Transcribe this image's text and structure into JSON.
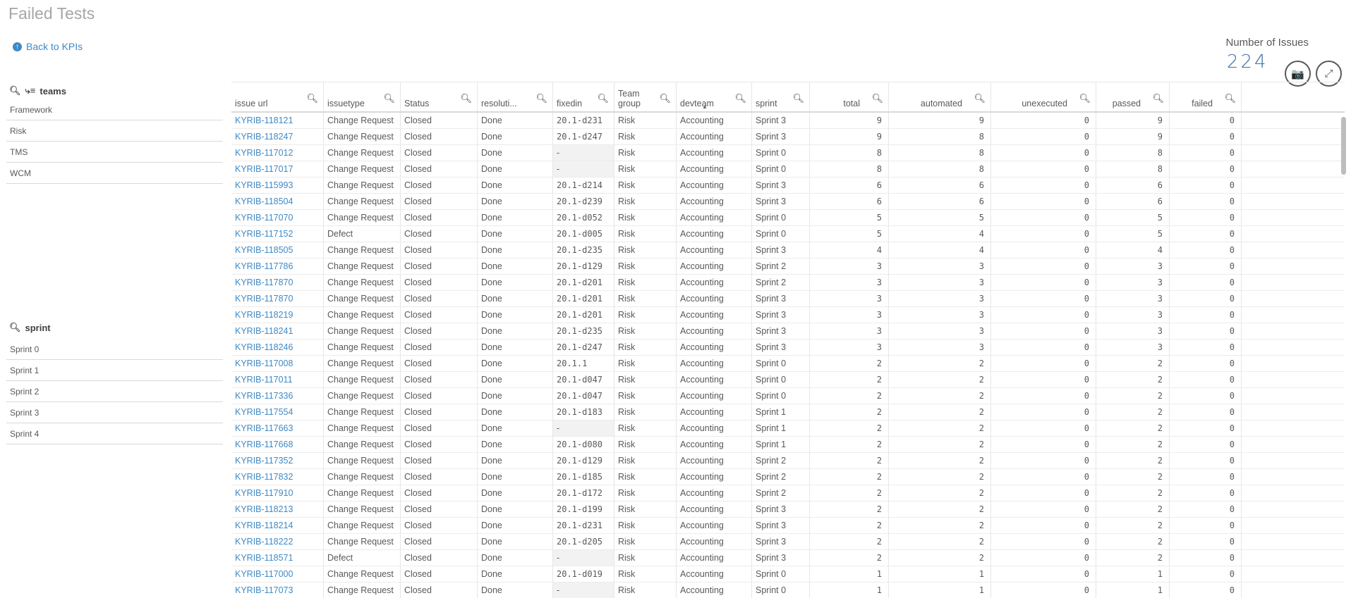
{
  "page_title": "Failed Tests",
  "back_link": "Back to KPIs",
  "kpi": {
    "label": "Number of Issues",
    "value": "224"
  },
  "filters": {
    "teams": {
      "label": "teams",
      "items": [
        "Framework",
        "Risk",
        "TMS",
        "WCM"
      ]
    },
    "sprint": {
      "label": "sprint",
      "items": [
        "Sprint 0",
        "Sprint 1",
        "Sprint 2",
        "Sprint 3",
        "Sprint 4"
      ]
    }
  },
  "table": {
    "columns": [
      "issue url",
      "issuetype",
      "Status",
      "resoluti...",
      "fixedin",
      "Team group",
      "devteam",
      "sprint",
      "total",
      "automated",
      "unexecuted",
      "passed",
      "failed"
    ],
    "rows": [
      [
        "KYRIB-118121",
        "Change Request",
        "Closed",
        "Done",
        "20.1-d231",
        "Risk",
        "Accounting",
        "Sprint 3",
        "9",
        "9",
        "0",
        "9",
        "0"
      ],
      [
        "KYRIB-118247",
        "Change Request",
        "Closed",
        "Done",
        "20.1-d247",
        "Risk",
        "Accounting",
        "Sprint 3",
        "9",
        "8",
        "0",
        "9",
        "0"
      ],
      [
        "KYRIB-117012",
        "Change Request",
        "Closed",
        "Done",
        "-",
        "Risk",
        "Accounting",
        "Sprint 0",
        "8",
        "8",
        "0",
        "8",
        "0"
      ],
      [
        "KYRIB-117017",
        "Change Request",
        "Closed",
        "Done",
        "-",
        "Risk",
        "Accounting",
        "Sprint 0",
        "8",
        "8",
        "0",
        "8",
        "0"
      ],
      [
        "KYRIB-115993",
        "Change Request",
        "Closed",
        "Done",
        "20.1-d214",
        "Risk",
        "Accounting",
        "Sprint 3",
        "6",
        "6",
        "0",
        "6",
        "0"
      ],
      [
        "KYRIB-118504",
        "Change Request",
        "Closed",
        "Done",
        "20.1-d239",
        "Risk",
        "Accounting",
        "Sprint 3",
        "6",
        "6",
        "0",
        "6",
        "0"
      ],
      [
        "KYRIB-117070",
        "Change Request",
        "Closed",
        "Done",
        "20.1-d052",
        "Risk",
        "Accounting",
        "Sprint 0",
        "5",
        "5",
        "0",
        "5",
        "0"
      ],
      [
        "KYRIB-117152",
        "Defect",
        "Closed",
        "Done",
        "20.1-d005",
        "Risk",
        "Accounting",
        "Sprint 0",
        "5",
        "4",
        "0",
        "5",
        "0"
      ],
      [
        "KYRIB-118505",
        "Change Request",
        "Closed",
        "Done",
        "20.1-d235",
        "Risk",
        "Accounting",
        "Sprint 3",
        "4",
        "4",
        "0",
        "4",
        "0"
      ],
      [
        "KYRIB-117786",
        "Change Request",
        "Closed",
        "Done",
        "20.1-d129",
        "Risk",
        "Accounting",
        "Sprint 2",
        "3",
        "3",
        "0",
        "3",
        "0"
      ],
      [
        "KYRIB-117870",
        "Change Request",
        "Closed",
        "Done",
        "20.1-d201",
        "Risk",
        "Accounting",
        "Sprint 2",
        "3",
        "3",
        "0",
        "3",
        "0"
      ],
      [
        "KYRIB-117870",
        "Change Request",
        "Closed",
        "Done",
        "20.1-d201",
        "Risk",
        "Accounting",
        "Sprint 3",
        "3",
        "3",
        "0",
        "3",
        "0"
      ],
      [
        "KYRIB-118219",
        "Change Request",
        "Closed",
        "Done",
        "20.1-d201",
        "Risk",
        "Accounting",
        "Sprint 3",
        "3",
        "3",
        "0",
        "3",
        "0"
      ],
      [
        "KYRIB-118241",
        "Change Request",
        "Closed",
        "Done",
        "20.1-d235",
        "Risk",
        "Accounting",
        "Sprint 3",
        "3",
        "3",
        "0",
        "3",
        "0"
      ],
      [
        "KYRIB-118246",
        "Change Request",
        "Closed",
        "Done",
        "20.1-d247",
        "Risk",
        "Accounting",
        "Sprint 3",
        "3",
        "3",
        "0",
        "3",
        "0"
      ],
      [
        "KYRIB-117008",
        "Change Request",
        "Closed",
        "Done",
        "20.1.1",
        "Risk",
        "Accounting",
        "Sprint 0",
        "2",
        "2",
        "0",
        "2",
        "0"
      ],
      [
        "KYRIB-117011",
        "Change Request",
        "Closed",
        "Done",
        "20.1-d047",
        "Risk",
        "Accounting",
        "Sprint 0",
        "2",
        "2",
        "0",
        "2",
        "0"
      ],
      [
        "KYRIB-117336",
        "Change Request",
        "Closed",
        "Done",
        "20.1-d047",
        "Risk",
        "Accounting",
        "Sprint 0",
        "2",
        "2",
        "0",
        "2",
        "0"
      ],
      [
        "KYRIB-117554",
        "Change Request",
        "Closed",
        "Done",
        "20.1-d183",
        "Risk",
        "Accounting",
        "Sprint 1",
        "2",
        "2",
        "0",
        "2",
        "0"
      ],
      [
        "KYRIB-117663",
        "Change Request",
        "Closed",
        "Done",
        "-",
        "Risk",
        "Accounting",
        "Sprint 1",
        "2",
        "2",
        "0",
        "2",
        "0"
      ],
      [
        "KYRIB-117668",
        "Change Request",
        "Closed",
        "Done",
        "20.1-d080",
        "Risk",
        "Accounting",
        "Sprint 1",
        "2",
        "2",
        "0",
        "2",
        "0"
      ],
      [
        "KYRIB-117352",
        "Change Request",
        "Closed",
        "Done",
        "20.1-d129",
        "Risk",
        "Accounting",
        "Sprint 2",
        "2",
        "2",
        "0",
        "2",
        "0"
      ],
      [
        "KYRIB-117832",
        "Change Request",
        "Closed",
        "Done",
        "20.1-d185",
        "Risk",
        "Accounting",
        "Sprint 2",
        "2",
        "2",
        "0",
        "2",
        "0"
      ],
      [
        "KYRIB-117910",
        "Change Request",
        "Closed",
        "Done",
        "20.1-d172",
        "Risk",
        "Accounting",
        "Sprint 2",
        "2",
        "2",
        "0",
        "2",
        "0"
      ],
      [
        "KYRIB-118213",
        "Change Request",
        "Closed",
        "Done",
        "20.1-d199",
        "Risk",
        "Accounting",
        "Sprint 3",
        "2",
        "2",
        "0",
        "2",
        "0"
      ],
      [
        "KYRIB-118214",
        "Change Request",
        "Closed",
        "Done",
        "20.1-d231",
        "Risk",
        "Accounting",
        "Sprint 3",
        "2",
        "2",
        "0",
        "2",
        "0"
      ],
      [
        "KYRIB-118222",
        "Change Request",
        "Closed",
        "Done",
        "20.1-d205",
        "Risk",
        "Accounting",
        "Sprint 3",
        "2",
        "2",
        "0",
        "2",
        "0"
      ],
      [
        "KYRIB-118571",
        "Defect",
        "Closed",
        "Done",
        "-",
        "Risk",
        "Accounting",
        "Sprint 3",
        "2",
        "2",
        "0",
        "2",
        "0"
      ],
      [
        "KYRIB-117000",
        "Change Request",
        "Closed",
        "Done",
        "20.1-d019",
        "Risk",
        "Accounting",
        "Sprint 0",
        "1",
        "1",
        "0",
        "1",
        "0"
      ],
      [
        "KYRIB-117073",
        "Change Request",
        "Closed",
        "Done",
        "-",
        "Risk",
        "Accounting",
        "Sprint 0",
        "1",
        "1",
        "0",
        "1",
        "0"
      ]
    ]
  }
}
